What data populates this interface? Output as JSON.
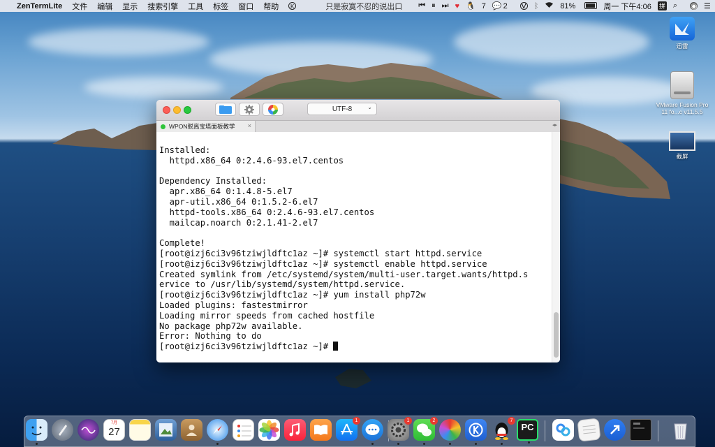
{
  "menubar": {
    "apple_glyph": "",
    "app_name": "ZenTermLite",
    "menus": [
      "文件",
      "编辑",
      "显示",
      "搜索引擎",
      "工具",
      "标签",
      "窗口",
      "帮助"
    ],
    "now_playing": "只是寂寞不忍的说出口",
    "qq_count": "7",
    "wechat_count": "2",
    "battery_percent": "81%",
    "clock": "周一 下午4:06",
    "input_method": "拼"
  },
  "desktop": {
    "icons": [
      {
        "label": "迅雷"
      },
      {
        "label": "VMware Fusion Pro 11 fo...c v11.5.5"
      },
      {
        "label": "截屏"
      }
    ]
  },
  "window": {
    "encoding": "UTF-8",
    "tab_title": "WPON脱离宝塔面板教学",
    "tab_close": "×",
    "terminal_lines": [
      "Installed:",
      "  httpd.x86_64 0:2.4.6-93.el7.centos",
      "",
      "Dependency Installed:",
      "  apr.x86_64 0:1.4.8-5.el7",
      "  apr-util.x86_64 0:1.5.2-6.el7",
      "  httpd-tools.x86_64 0:2.4.6-93.el7.centos",
      "  mailcap.noarch 0:2.1.41-2.el7",
      "",
      "Complete!",
      "[root@izj6ci3v96tziwjldftc1az ~]# systemctl start httpd.service",
      "[root@izj6ci3v96tziwjldftc1az ~]# systemctl enable httpd.service",
      "Created symlink from /etc/systemd/system/multi-user.target.wants/httpd.s",
      "ervice to /usr/lib/systemd/system/httpd.service.",
      "[root@izj6ci3v96tziwjldftc1az ~]# yum install php72w",
      "Loaded plugins: fastestmirror",
      "Loading mirror speeds from cached hostfile",
      "No package php72w available.",
      "Error: Nothing to do"
    ],
    "prompt": "[root@izj6ci3v96tziwjldftc1az ~]# "
  },
  "dock": {
    "calendar_month": "7月",
    "calendar_day": "27",
    "badges": {
      "app_store": "1",
      "system_prefs": "1",
      "wechat": "2",
      "qq": "7"
    },
    "pycharm_label": "PC"
  }
}
